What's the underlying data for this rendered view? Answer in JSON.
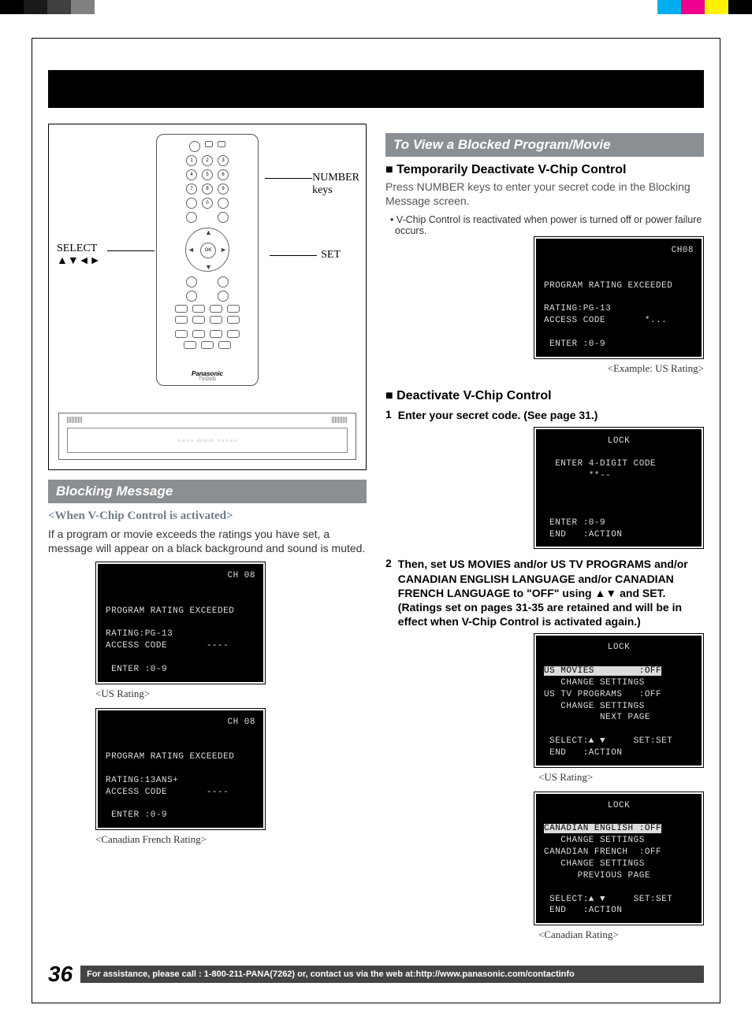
{
  "color_swatches_left": [
    "#000000",
    "#0f0f0f",
    "#404040",
    "#808080"
  ],
  "color_swatches_right": [
    "#00aeef",
    "#ec008c",
    "#fff200",
    "#000000"
  ],
  "remote": {
    "callout_select": "SELECT\n▲▼◄►",
    "callout_numbers": "NUMBER\nkeys",
    "callout_set": "SET",
    "brand": "Panasonic",
    "model": "TV/DVD",
    "ok": "OK"
  },
  "left": {
    "section_title": "Blocking Message",
    "subheading": "<When V-Chip Control is activated>",
    "body": "If a program or movie exceeds the ratings you have set, a message will appear on a black background and sound is muted.",
    "osd1": {
      "ch": "CH 08",
      "l1": "PROGRAM RATING EXCEEDED",
      "l2": "RATING:PG-13",
      "l3": "ACCESS CODE       ----",
      "l4": " ENTER :0-9"
    },
    "caption1": "<US Rating>",
    "osd2": {
      "ch": "CH 08",
      "l1": "PROGRAM RATING EXCEEDED",
      "l2": "RATING:13ANS+",
      "l3": "ACCESS CODE       ----",
      "l4": " ENTER :0-9"
    },
    "caption2": "<Canadian French Rating>"
  },
  "right": {
    "section_title": "To View a Blocked Program/Movie",
    "h_temp": "Temporarily Deactivate V-Chip Control",
    "p_temp": "Press NUMBER keys to enter your secret code in the Blocking Message screen.",
    "note_temp": "• V-Chip Control is reactivated when power is turned off or power failure occurs.",
    "osd_example": {
      "ch": "CH08",
      "l1": "PROGRAM RATING EXCEEDED",
      "l2": "RATING:PG-13",
      "l3": "ACCESS CODE       *...",
      "l4": " ENTER :0-9"
    },
    "caption_example": "<Example: US Rating>",
    "h_deact": "Deactivate V-Chip Control",
    "step1": "Enter your secret code. (See page 31.)",
    "osd_lock1": {
      "title": "LOCK",
      "l1": "  ENTER 4-DIGIT CODE",
      "l2": "        **--",
      "l3": " ENTER :0-9",
      "l4": " END   :ACTION"
    },
    "step2": "Then, set US MOVIES and/or US TV PROGRAMS and/or CANADIAN ENGLISH LANGUAGE and/or CANADIAN FRENCH LANGUAGE to \"OFF\" using ▲▼ and SET. (Ratings set on pages 31-35 are retained and will be in effect when V-Chip Control is activated again.)",
    "osd_us": {
      "title": "LOCK",
      "r1_inv": "US MOVIES        :OFF",
      "r2": "   CHANGE SETTINGS",
      "r3": "US TV PROGRAMS   :OFF",
      "r4": "   CHANGE SETTINGS",
      "r5": "          NEXT PAGE",
      "f1": " SELECT:▲ ▼     SET:SET",
      "f2": " END   :ACTION"
    },
    "caption_us": "<US Rating>",
    "osd_ca": {
      "title": "LOCK",
      "r1_inv": "CANADIAN ENGLISH :OFF",
      "r2": "   CHANGE SETTINGS",
      "r3": "CANADIAN FRENCH  :OFF",
      "r4": "   CHANGE SETTINGS",
      "r5": "      PREVIOUS PAGE",
      "f1": " SELECT:▲ ▼     SET:SET",
      "f2": " END   :ACTION"
    },
    "caption_ca": "<Canadian Rating>"
  },
  "footer": {
    "page": "36",
    "text": "For assistance, please call : 1-800-211-PANA(7262) or, contact us via the web at:http://www.panasonic.com/contactinfo"
  }
}
